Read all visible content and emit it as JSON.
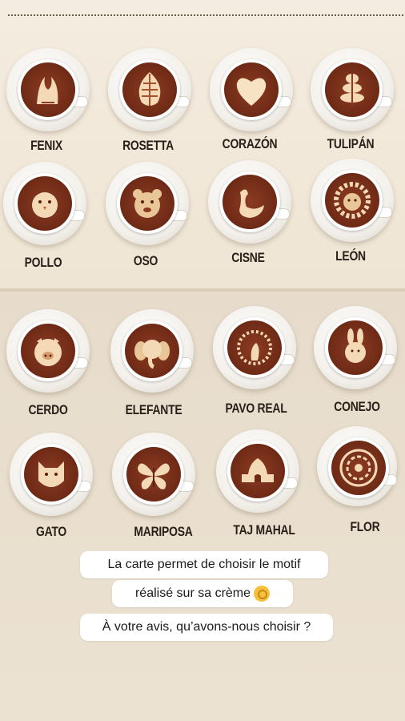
{
  "menu": {
    "row1": [
      "FENIX",
      "ROSETTA",
      "CORAZÓN",
      "TULIPÁN"
    ],
    "row2": [
      "POLLO",
      "OSO",
      "CISNE",
      "LEÓN"
    ],
    "row3": [
      "CERDO",
      "ELEFANTE",
      "PAVO REAL",
      "CONEJO"
    ],
    "row4": [
      "GATO",
      "MARIPOSA",
      "TAJ MAHAL",
      "FLOR"
    ]
  },
  "caption": {
    "line1": "La carte permet de choisir le motif",
    "line2": "réalisé sur sa crème",
    "emoji": "ok-hand-emoji",
    "question": "À votre avis, qu’avons-nous choisir ?"
  },
  "colors": {
    "coffee": "#6e2a16",
    "foam": "#f3d9b5",
    "label": "#2a1f18"
  }
}
